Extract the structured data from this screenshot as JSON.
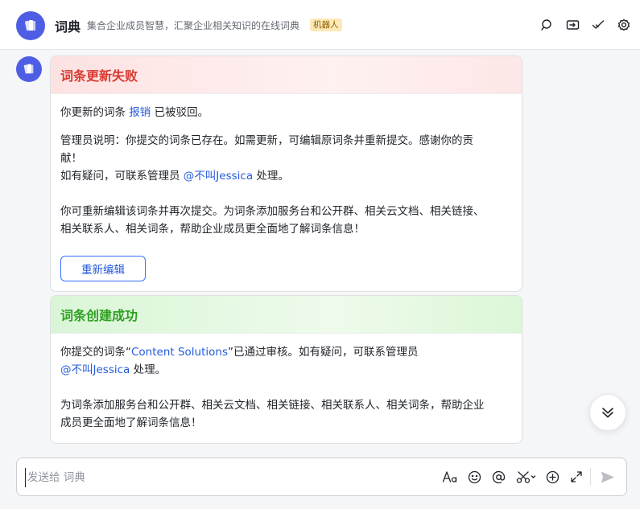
{
  "header": {
    "title": "词典",
    "description": "集合企业成员智慧，汇聚企业相关知识的在线词典",
    "badge": "机器人",
    "icons": [
      "search-icon",
      "share-icon",
      "tasks-check-icon",
      "settings-icon"
    ]
  },
  "cards": [
    {
      "title": "词条更新失败",
      "line1_prefix": "你更新的词条",
      "line1_link": "报销",
      "line1_suffix": "已被驳回。",
      "note_line1": "管理员说明：你提交的词条已存在。如需更新，可编辑原词条并重新提交。感谢你的贡",
      "note_line2": "献！",
      "contact_prefix": "如有疑问，可联系管理员",
      "contact_mention": "@不叫Jessica",
      "contact_suffix": "处理。",
      "tip_line1": "你可重新编辑该词条并再次提交。为词条添加服务台和公开群、相关云文档、相关链接、",
      "tip_line2": "相关联系人、相关词条，帮助企业成员更全面地了解词条信息！",
      "button_label": "重新编辑"
    },
    {
      "title": "词条创建成功",
      "line1_prefix": "你提交的词条“",
      "line1_link": "Content Solutions",
      "line1_suffix": "”已通过审核。如有疑问，可联系管理员",
      "mention": "@不叫Jessica",
      "mention_suffix": "处理。",
      "tip_line1": "为词条添加服务台和公开群、相关云文档、相关链接、相关联系人、相关词条，帮助企业",
      "tip_line2": "成员更全面地了解词条信息！"
    }
  ],
  "composer": {
    "placeholder": "发送给 词典"
  },
  "colors": {
    "accent": "#3370ff",
    "link": "#245bdb",
    "error": "#d83931",
    "success": "#2ea121",
    "bot_avatar": "#4e5ee4"
  }
}
